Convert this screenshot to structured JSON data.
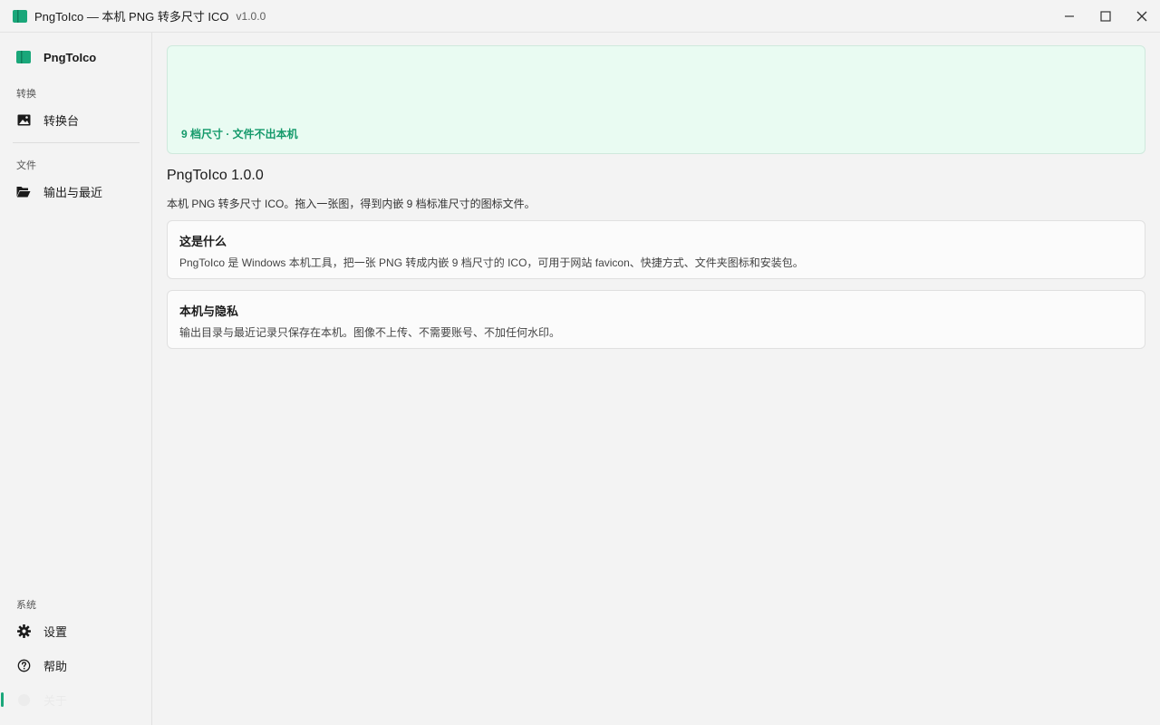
{
  "window": {
    "title": "PngToIco — 本机 PNG 转多尺寸 ICO",
    "version": "v1.0.0"
  },
  "sidebar": {
    "brand": "PngToIco",
    "sections": {
      "convert": "转换",
      "files": "文件",
      "system": "系统"
    },
    "items": [
      {
        "label": "转换台",
        "icon": "image-icon"
      },
      {
        "label": "输出与最近",
        "icon": "folder-open-icon"
      },
      {
        "label": "设置",
        "icon": "gear-icon"
      },
      {
        "label": "帮助",
        "icon": "help-circle-icon"
      },
      {
        "label": "关于",
        "icon": "info-icon",
        "active": true
      }
    ]
  },
  "main": {
    "hero_text": "9 档尺寸 · 文件不出本机",
    "about_title": "PngToIco 1.0.0",
    "about_desc": "本机 PNG 转多尺寸 ICO。拖入一张图，得到内嵌 9 档标准尺寸的图标文件。",
    "cards": [
      {
        "title": "这是什么",
        "body": "PngToIco 是 Windows 本机工具，把一张 PNG 转成内嵌 9 档尺寸的 ICO，可用于网站 favicon、快捷方式、文件夹图标和安装包。"
      },
      {
        "title": "本机与隐私",
        "body": "输出目录与最近记录只保存在本机。图像不上传、不需要账号、不加任何水印。"
      }
    ]
  },
  "colors": {
    "accent": "#1aa77a",
    "hero_bg": "#e9fbf2",
    "hero_text": "#159a6b"
  }
}
